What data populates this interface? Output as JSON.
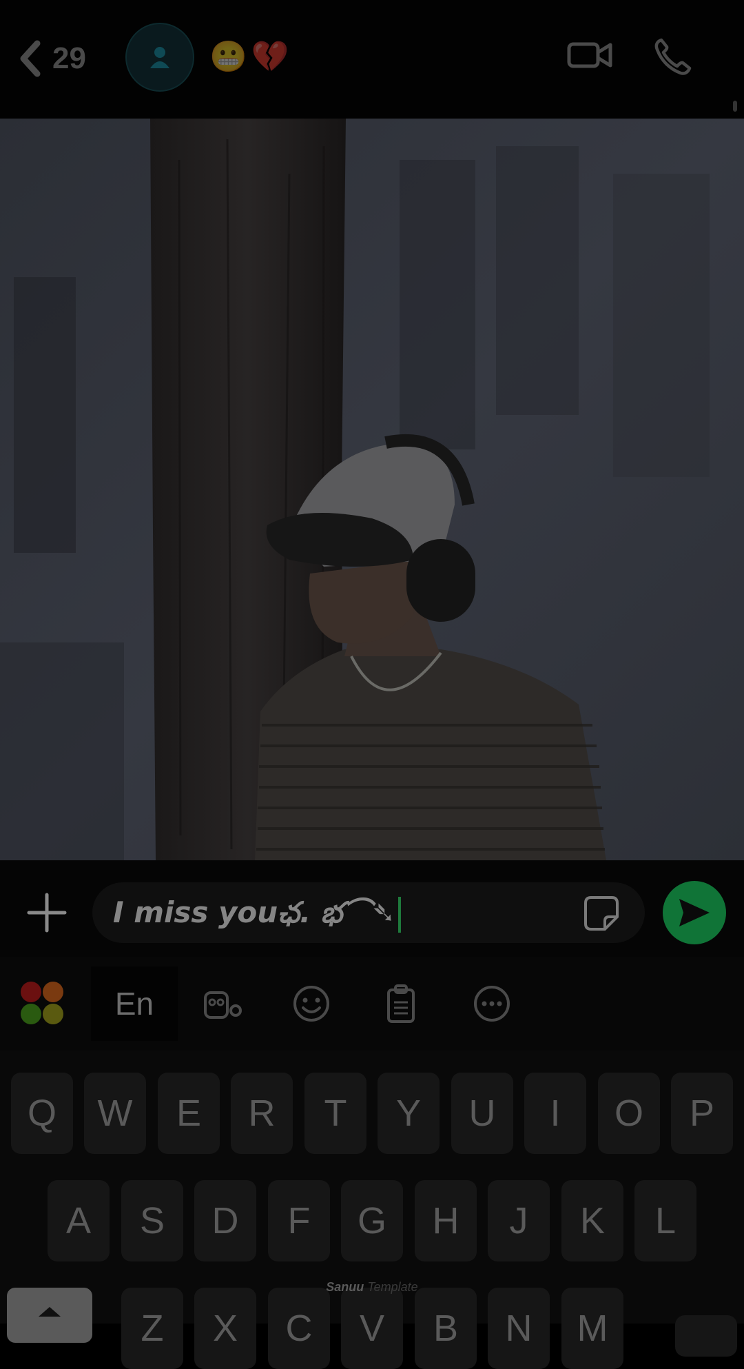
{
  "header": {
    "back_count": "29",
    "emojis": [
      "😬",
      "💔"
    ]
  },
  "composer": {
    "message": "I miss youఛ. భ⌒➴"
  },
  "keyboard": {
    "lang_tab": "En",
    "rows": [
      [
        "Q",
        "W",
        "E",
        "R",
        "T",
        "Y",
        "U",
        "I",
        "O",
        "P"
      ],
      [
        "A",
        "S",
        "D",
        "F",
        "G",
        "H",
        "J",
        "K",
        "L"
      ],
      [
        "Z",
        "X",
        "C",
        "V",
        "B",
        "N",
        "M"
      ]
    ],
    "watermark_name": "Sanuu",
    "watermark_word": "Template"
  },
  "colors": {
    "send_button": "#107437",
    "caret": "#1e7a3c"
  },
  "icons": [
    "back-chevron-icon",
    "avatar-person-icon",
    "video-call-icon",
    "phone-icon",
    "plus-icon",
    "sticker-icon",
    "send-icon",
    "apps-icon",
    "sticker-keyboard-icon",
    "emoji-icon",
    "clipboard-icon",
    "more-icon",
    "shift-icon"
  ]
}
